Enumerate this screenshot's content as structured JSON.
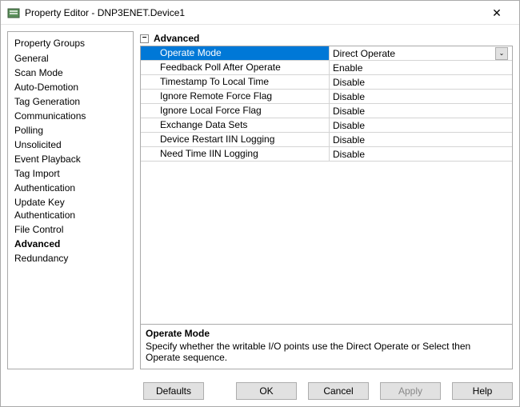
{
  "window": {
    "title": "Property Editor - DNP3ENET.Device1"
  },
  "sidebar": {
    "header": "Property Groups",
    "items": [
      {
        "label": "General"
      },
      {
        "label": "Scan Mode"
      },
      {
        "label": "Auto-Demotion"
      },
      {
        "label": "Tag Generation"
      },
      {
        "label": "Communications"
      },
      {
        "label": "Polling"
      },
      {
        "label": "Unsolicited"
      },
      {
        "label": "Event Playback"
      },
      {
        "label": "Tag Import"
      },
      {
        "label": "Authentication"
      },
      {
        "label": "Update Key Authentication"
      },
      {
        "label": "File Control"
      },
      {
        "label": "Advanced",
        "selected": true
      },
      {
        "label": "Redundancy"
      }
    ]
  },
  "section": {
    "title": "Advanced",
    "expander": "−"
  },
  "grid": {
    "rows": [
      {
        "name": "Operate Mode",
        "value": "Direct Operate",
        "selected": true,
        "dropdown": true
      },
      {
        "name": "Feedback Poll After Operate",
        "value": "Enable"
      },
      {
        "name": "Timestamp To Local Time",
        "value": "Disable"
      },
      {
        "name": "Ignore Remote Force Flag",
        "value": "Disable"
      },
      {
        "name": "Ignore Local Force Flag",
        "value": "Disable"
      },
      {
        "name": "Exchange Data Sets",
        "value": "Disable"
      },
      {
        "name": "Device Restart IIN Logging",
        "value": "Disable"
      },
      {
        "name": "Need Time IIN Logging",
        "value": "Disable"
      }
    ]
  },
  "description": {
    "title": "Operate Mode",
    "text": "Specify whether the writable I/O points use the Direct Operate or Select then Operate sequence."
  },
  "buttons": {
    "defaults": "Defaults",
    "ok": "OK",
    "cancel": "Cancel",
    "apply": "Apply",
    "help": "Help"
  }
}
